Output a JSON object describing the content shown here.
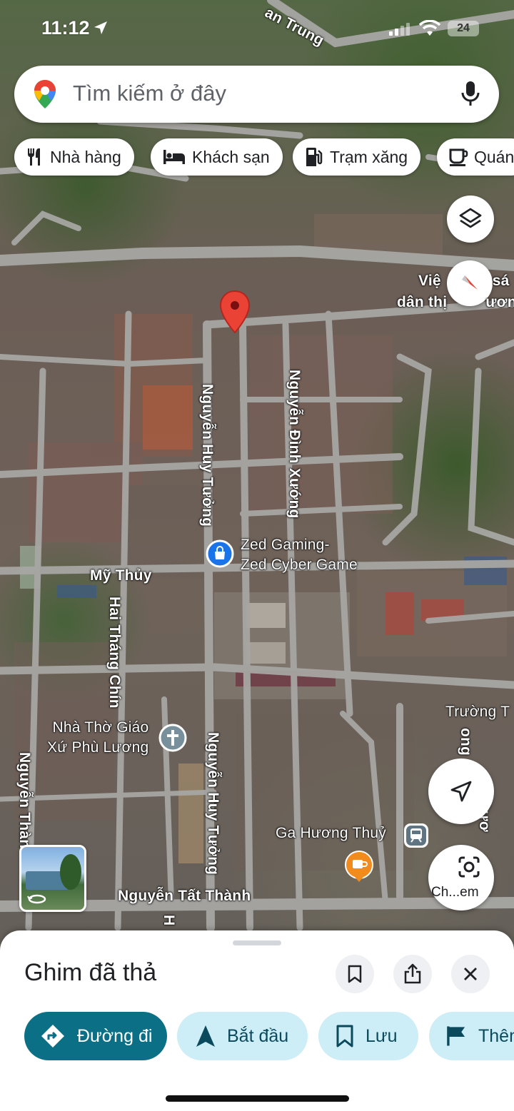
{
  "status_bar": {
    "time": "11:12",
    "battery": "24"
  },
  "search": {
    "placeholder": "Tìm kiếm ở đây"
  },
  "chips": [
    {
      "label": "Nhà hàng",
      "icon": "restaurant-icon"
    },
    {
      "label": "Khách sạn",
      "icon": "hotel-icon"
    },
    {
      "label": "Trạm xăng",
      "icon": "gas-station-icon"
    },
    {
      "label": "Quán",
      "icon": "cafe-icon"
    }
  ],
  "map": {
    "labels": {
      "top_street": "an Trung",
      "poi_top_right_1": "Việ",
      "poi_top_right_1b": "sá",
      "poi_top_right_2": "dân thị",
      "poi_top_right_2b": "ương",
      "street_nguyen_huy_tuong": "Nguyễn Huy Tưởng",
      "street_nguyen_dinh_xuong": "Nguyễn Đình Xướng",
      "poi_zed_line1": "Zed Gaming-",
      "poi_zed_line2": "Zed Cyber Game",
      "area_my_thuy": "Mỹ Thủy",
      "street_hai_thang_chin": "Hai Tháng Chín",
      "church_line1": "Nhà Thờ Giáo",
      "church_line2": "Xứ Phù Lương",
      "street_nguyen_huy_tuong_2": "Nguyễn Huy Tưởng",
      "street_nguyen_than": "Nguyễn Thàn",
      "street_ong": "ong",
      "street_vertical_right": "Dươ",
      "school": "Trường T",
      "station": "Ga Hương Thuỷ",
      "street_nguyen_tat_thanh": "Nguyễn Tất Thành",
      "street_h": "H"
    }
  },
  "fabs": {
    "lens_label": "Ch...em"
  },
  "sheet": {
    "title": "Ghim đã thả",
    "actions": [
      {
        "label": "Đường đi",
        "icon": "directions-icon"
      },
      {
        "label": "Bắt đầu",
        "icon": "navigation-arrow-icon"
      },
      {
        "label": "Lưu",
        "icon": "bookmark-icon"
      },
      {
        "label": "Thêm",
        "icon": "flag-icon"
      }
    ]
  },
  "colors": {
    "accent": "#0b6f85",
    "secondary_bg": "#cdeef6",
    "pin_red": "#ea4335"
  }
}
